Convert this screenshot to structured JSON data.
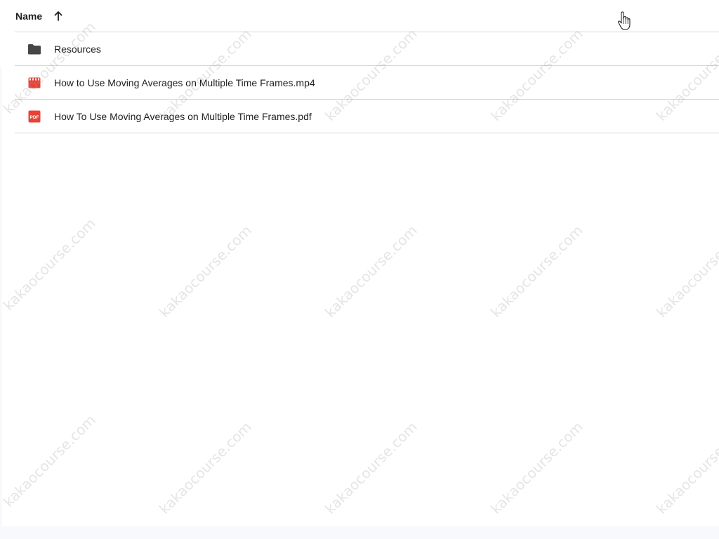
{
  "header": {
    "name_label": "Name",
    "sort_icon": "arrow-up-icon"
  },
  "files": [
    {
      "name": "Resources",
      "icon": "folder-icon",
      "type": "folder"
    },
    {
      "name": "How to Use Moving Averages on Multiple Time Frames.mp4",
      "icon": "video-file-icon",
      "type": "video"
    },
    {
      "name": "How To Use Moving Averages on Multiple Time Frames.pdf",
      "icon": "pdf-file-icon",
      "type": "pdf"
    }
  ],
  "watermark": "kakaocourse.com",
  "colors": {
    "folder": "#444746",
    "video": "#ea4335",
    "pdf": "#ea4335",
    "divider": "#d6d6d6"
  }
}
